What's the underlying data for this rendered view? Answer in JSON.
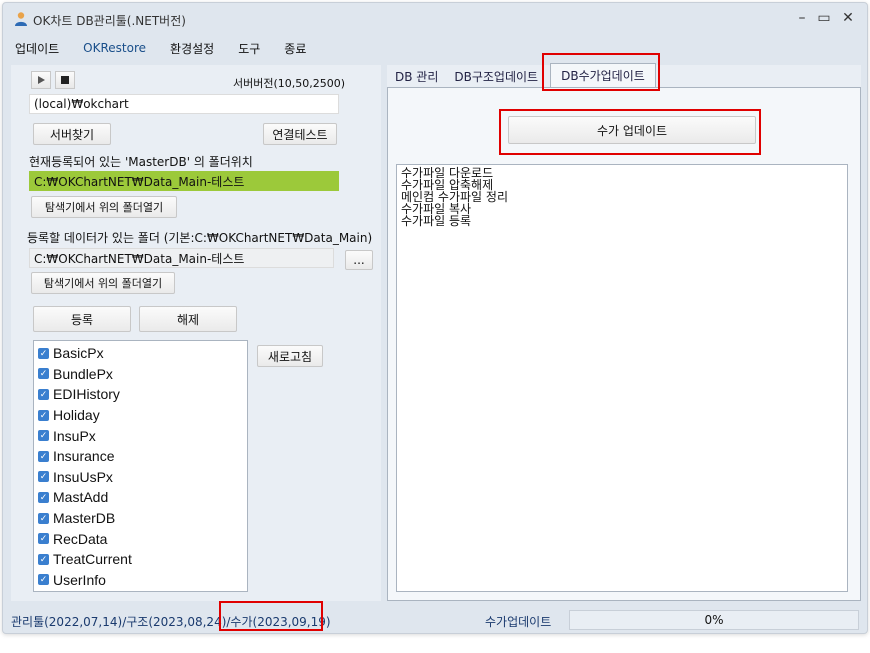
{
  "window": {
    "title": "OK차트 DB관리툴(.NET버전)",
    "controls": {
      "minimize": "–",
      "maximize": "▭",
      "close": "✕"
    }
  },
  "menu": {
    "items": [
      "업데이트",
      "OKRestore",
      "환경설정",
      "도구",
      "종료"
    ]
  },
  "left": {
    "server_version": "서버버전(10,50,2500)",
    "server_value": "(local)₩okchart",
    "find_server": "서버찾기",
    "connect_test": "연결테스트",
    "master_label": "현재등록되어 있는 'MasterDB' 의 폴더위치",
    "master_path": "C:₩OKChartNET₩Data_Main-테스트",
    "open_folder_1": "탐색기에서 위의 폴더열기",
    "register_label": "등록할 데이터가 있는 폴더 (기본:C:₩OKChartNET₩Data_Main)",
    "register_path": "C:₩OKChartNET₩Data_Main-테스트",
    "browse": "...",
    "open_folder_2": "탐색기에서 위의 폴더열기",
    "register_btn": "등록",
    "release_btn": "해제",
    "refresh_btn": "새로고침",
    "databases": [
      "BasicPx",
      "BundlePx",
      "EDIHistory",
      "Holiday",
      "InsuPx",
      "Insurance",
      "InsuUsPx",
      "MastAdd",
      "MasterDB",
      "RecData",
      "TreatCurrent",
      "UserInfo"
    ]
  },
  "right": {
    "tabs": [
      "DB 관리",
      "DB구조업데이트",
      "DB수가업데이트"
    ],
    "active_tab": "DB수가업데이트",
    "update_button": "수가 업데이트",
    "log_lines": [
      "수가파일 다운로드",
      "수가파일 압축해제",
      "메인컴 수가파일 정리",
      "수가파일 복사",
      "수가파일 등록"
    ]
  },
  "status": {
    "left": "관리툴(2022,07,14)/구조(2023,08,24)/수가(2023,09,19)",
    "mid": "수가업데이트",
    "progress": "0%"
  },
  "colors": {
    "highlight_green": "#9cc93a",
    "annotation_red": "#e00000",
    "checkbox_blue": "#3a7fcf"
  }
}
